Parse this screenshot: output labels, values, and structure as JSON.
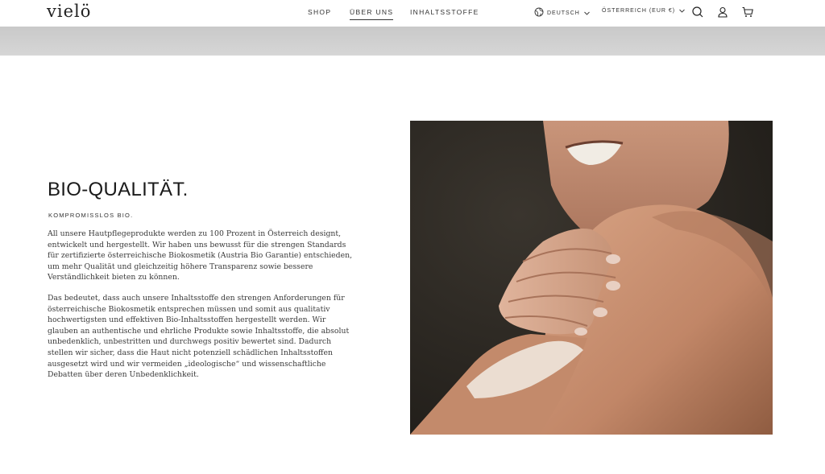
{
  "header": {
    "logo": "vielö",
    "nav": {
      "shop": "SHOP",
      "about": "ÜBER UNS",
      "ingredients": "INHALTSSTOFFE"
    },
    "language": "DEUTSCH",
    "country": "ÖSTERREICH (EUR €)",
    "icons": [
      "globe-icon",
      "search-icon",
      "account-icon",
      "cart-icon"
    ]
  },
  "main": {
    "title": "BIO-QUALITÄT.",
    "subtitle": "KOMPROMISSLOS BIO.",
    "paragraph1": "All unsere Hautpflegeprodukte werden zu 100 Prozent in Österreich designt, entwickelt und hergestellt. Wir haben uns bewusst für die strengen Standards für zertifizierte österreichische Biokosmetik (Austria Bio Garantie) entschieden, um mehr Qualität und gleichzeitig höhere Transparenz sowie bessere Verständlichkeit bieten zu können.",
    "paragraph2": "Das bedeutet, dass auch unsere Inhaltsstoffe den strengen Anforderungen für österreichische Biokosmetik entsprechen müssen und somit aus qualitativ hochwertigsten und effektiven Bio-Inhaltsstoffen hergestellt werden. Wir glauben an authentische und ehrliche Produkte sowie Inhaltsstoffe, die absolut unbedenklich, unbestritten und durchwegs positiv bewertet sind. Dadurch stellen wir sicher, dass die Haut nicht potenziell schädlichen Inhaltsstoffen ausgesetzt wird und wir vermeiden „ideologische“ und wissenschaftliche Debatten über deren Unbedenklichkeit."
  },
  "colors": {
    "text": "#1c1c1c",
    "band": "#cfcfcf",
    "photo_background": "#2f2b26",
    "skin": "#c98f6f"
  }
}
